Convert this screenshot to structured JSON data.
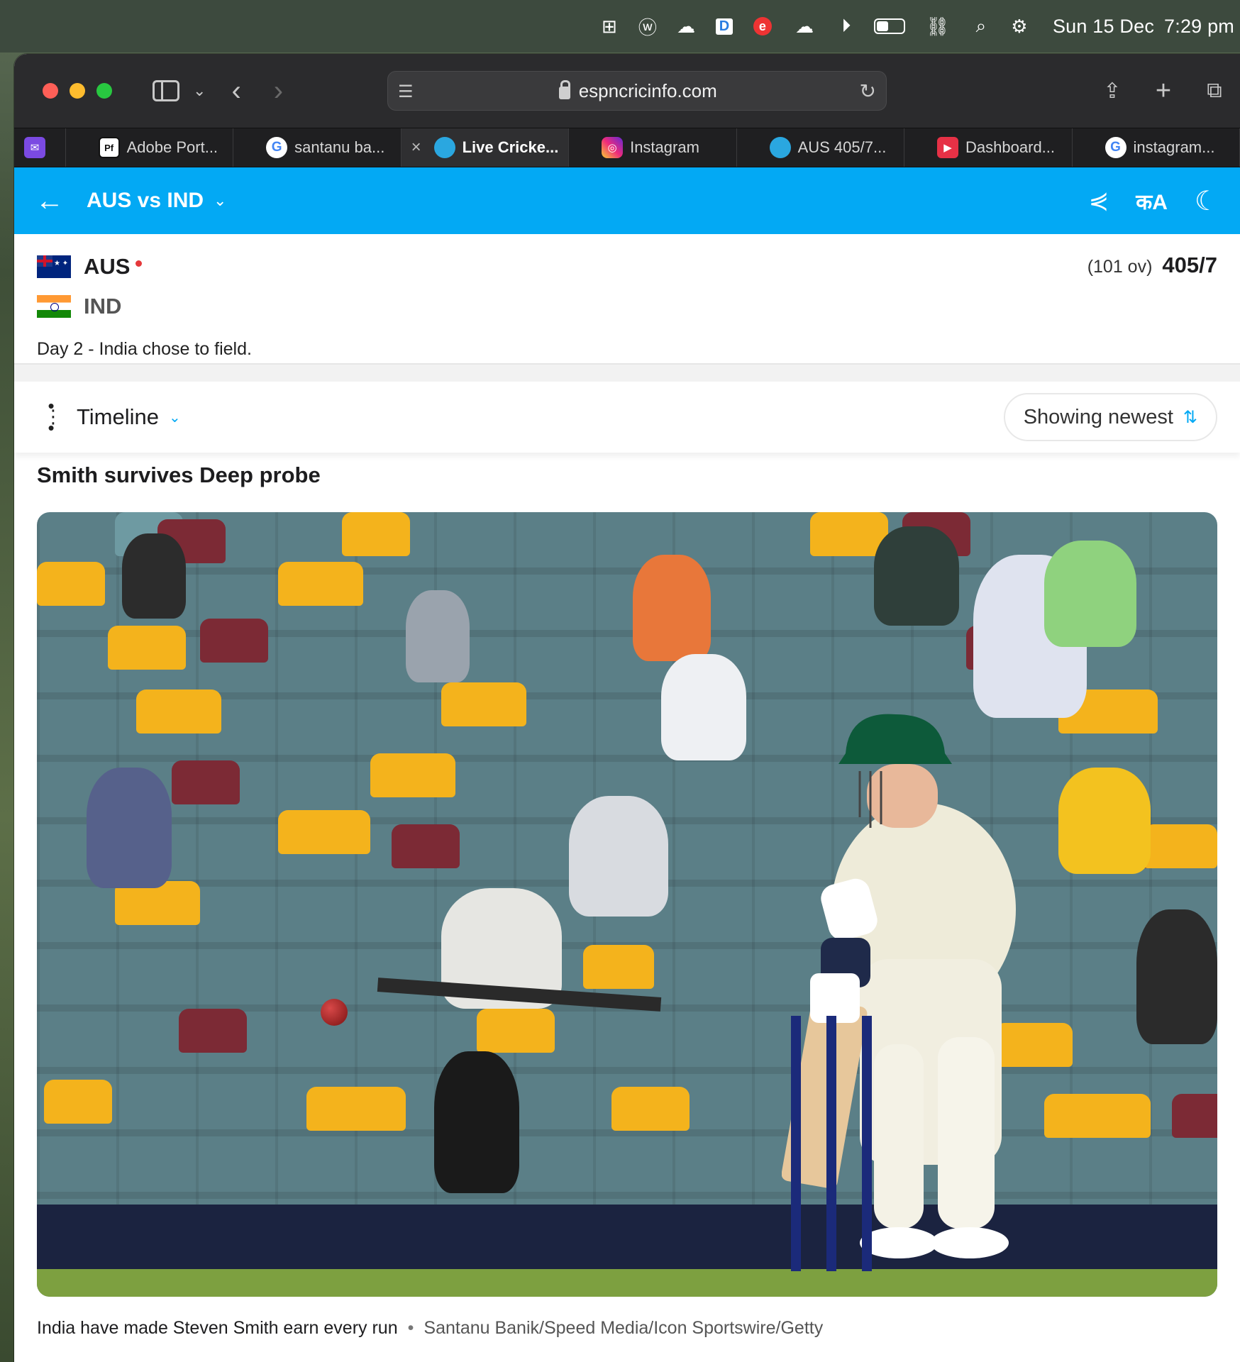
{
  "menubar": {
    "icons": [
      "launchpad-icon",
      "w-icon",
      "cloud-sync-icon",
      "d-app-icon",
      "e-app-icon",
      "onedrive-icon",
      "play-icon",
      "battery-icon",
      "link-icon",
      "search-icon",
      "control-center-icon"
    ],
    "date": "Sun 15 Dec",
    "time": "7:29 pm"
  },
  "browser": {
    "url": "espncricinfo.com",
    "tabs": [
      {
        "label": "",
        "favicon": "mail-icon"
      },
      {
        "label": "Adobe Port...",
        "favicon": "Pf"
      },
      {
        "label": "santanu ba...",
        "favicon": "G"
      },
      {
        "label": "Live Cricke...",
        "favicon": "cricinfo-icon",
        "active": true
      },
      {
        "label": "Instagram",
        "favicon": "instagram-icon"
      },
      {
        "label": "AUS 405/7...",
        "favicon": "cricinfo-icon"
      },
      {
        "label": "Dashboard...",
        "favicon": "dashboard-icon"
      },
      {
        "label": "instagram...",
        "favicon": "G"
      }
    ]
  },
  "header": {
    "title": "AUS vs IND"
  },
  "scorecard": {
    "team1": "AUS",
    "team2": "IND",
    "overs": "(101 ov)",
    "score": "405/7",
    "status": "Day 2 - India chose to field."
  },
  "timeline": {
    "label": "Timeline",
    "sort_label": "Showing newest"
  },
  "article": {
    "headline": "Smith survives Deep probe",
    "caption": "India have made Steven Smith earn every run",
    "credit": "Santanu Banik/Speed Media/Icon Sportswire/Getty"
  },
  "colors": {
    "espn_blue": "#03a9f4",
    "live_red": "#e5383b"
  }
}
